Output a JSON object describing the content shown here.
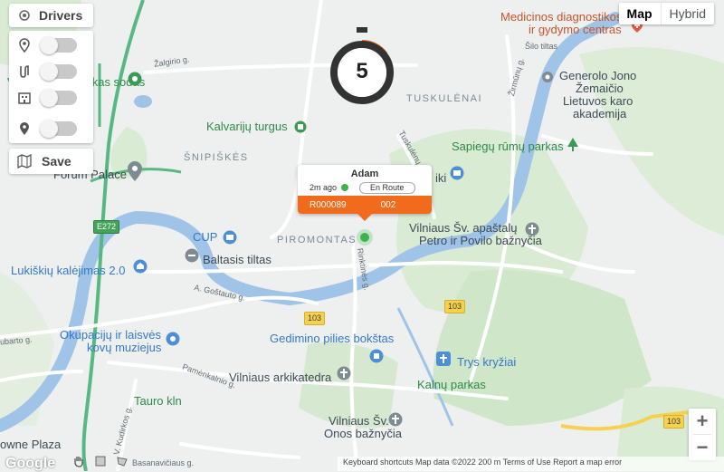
{
  "map": {
    "labels": {
      "medicinos": "Medicinos diagnostikos",
      "medicinos2": "ir gydymo centras",
      "generolo1": "Generolo Jono",
      "generolo2": "Žemaičio",
      "generolo3": "Lietuvos karo",
      "generolo4": "akademija",
      "sapiegu": "Sapiegų rūmų parkas",
      "kalvariju": "Kalvarijų turgus",
      "jaunimo": "Vilniaus Japoniškas sodas",
      "forum": "Forum Palace",
      "cup": "CUP",
      "baltasis": "Baltasis tiltas",
      "lukiskiu": "Lukiškių kalėjimas 2.0",
      "okupaciju1": "Okupacijų ir laisvės",
      "okupaciju2": "kovų muziejus",
      "gedimino": "Gedimino pilies bokštas",
      "trys": "Trys kryžiai",
      "kalnu": "Kalnų parkas",
      "arkikatedra": "Vilniaus arkikatedra",
      "tauro": "Tauro kln",
      "onos1": "Vilniaus Šv.",
      "onos2": "Onos bažnyčia",
      "petro1": "Vilniaus Šv. apaštalų",
      "petro2": "Petro ir Povilo bažnyčia",
      "towne": "owne Plaza",
      "iki": "iki"
    },
    "districts": {
      "tuskulenai": "TUSKULĖNAI",
      "snipiskes": "ŠNIPIŠKĖS",
      "piromontas": "PIROMONTAS"
    },
    "streets": {
      "zalgirio": "Žalgirio g.",
      "zirmunu": "Žirmūnų g.",
      "silo": "Šilo tiltas",
      "gostauto": "A. Goštauto g.",
      "tuskulenu": "Tuskulėnų g.",
      "rinktines": "Rinktinės g.",
      "pamenkalnio": "Pamėnkalnio g.",
      "kudirkos": "V. Kudirkos g.",
      "basanaviciaus": "Basanavičiaus g.",
      "jubarto": "ubarto g."
    },
    "shields": {
      "e272": "E272",
      "r103a": "103",
      "r103b": "103",
      "r103c": "103"
    }
  },
  "controls": {
    "drivers_label": "Drivers",
    "save_label": "Save",
    "toggles": [
      {
        "icon": "map-pin-icon",
        "on": false
      },
      {
        "icon": "route-icon",
        "on": false
      },
      {
        "icon": "building-icon",
        "on": false
      },
      {
        "icon": "location-icon",
        "on": false
      }
    ]
  },
  "map_type": {
    "map": "Map",
    "hybrid": "Hybrid",
    "selected": "Map"
  },
  "timer": {
    "value": "5"
  },
  "driver_card": {
    "name": "Adam",
    "last_seen": "2m ago",
    "status": "En Route",
    "order_id": "R000089",
    "order_no": "002",
    "status_color": "#3bb54a",
    "accent": "#f26a1b"
  },
  "zoom": {
    "in": "+",
    "out": "−"
  },
  "footer": {
    "google": "Google",
    "attribution": "Keyboard shortcuts   Map data ©2022   200 m   Terms of Use   Report a map error"
  }
}
